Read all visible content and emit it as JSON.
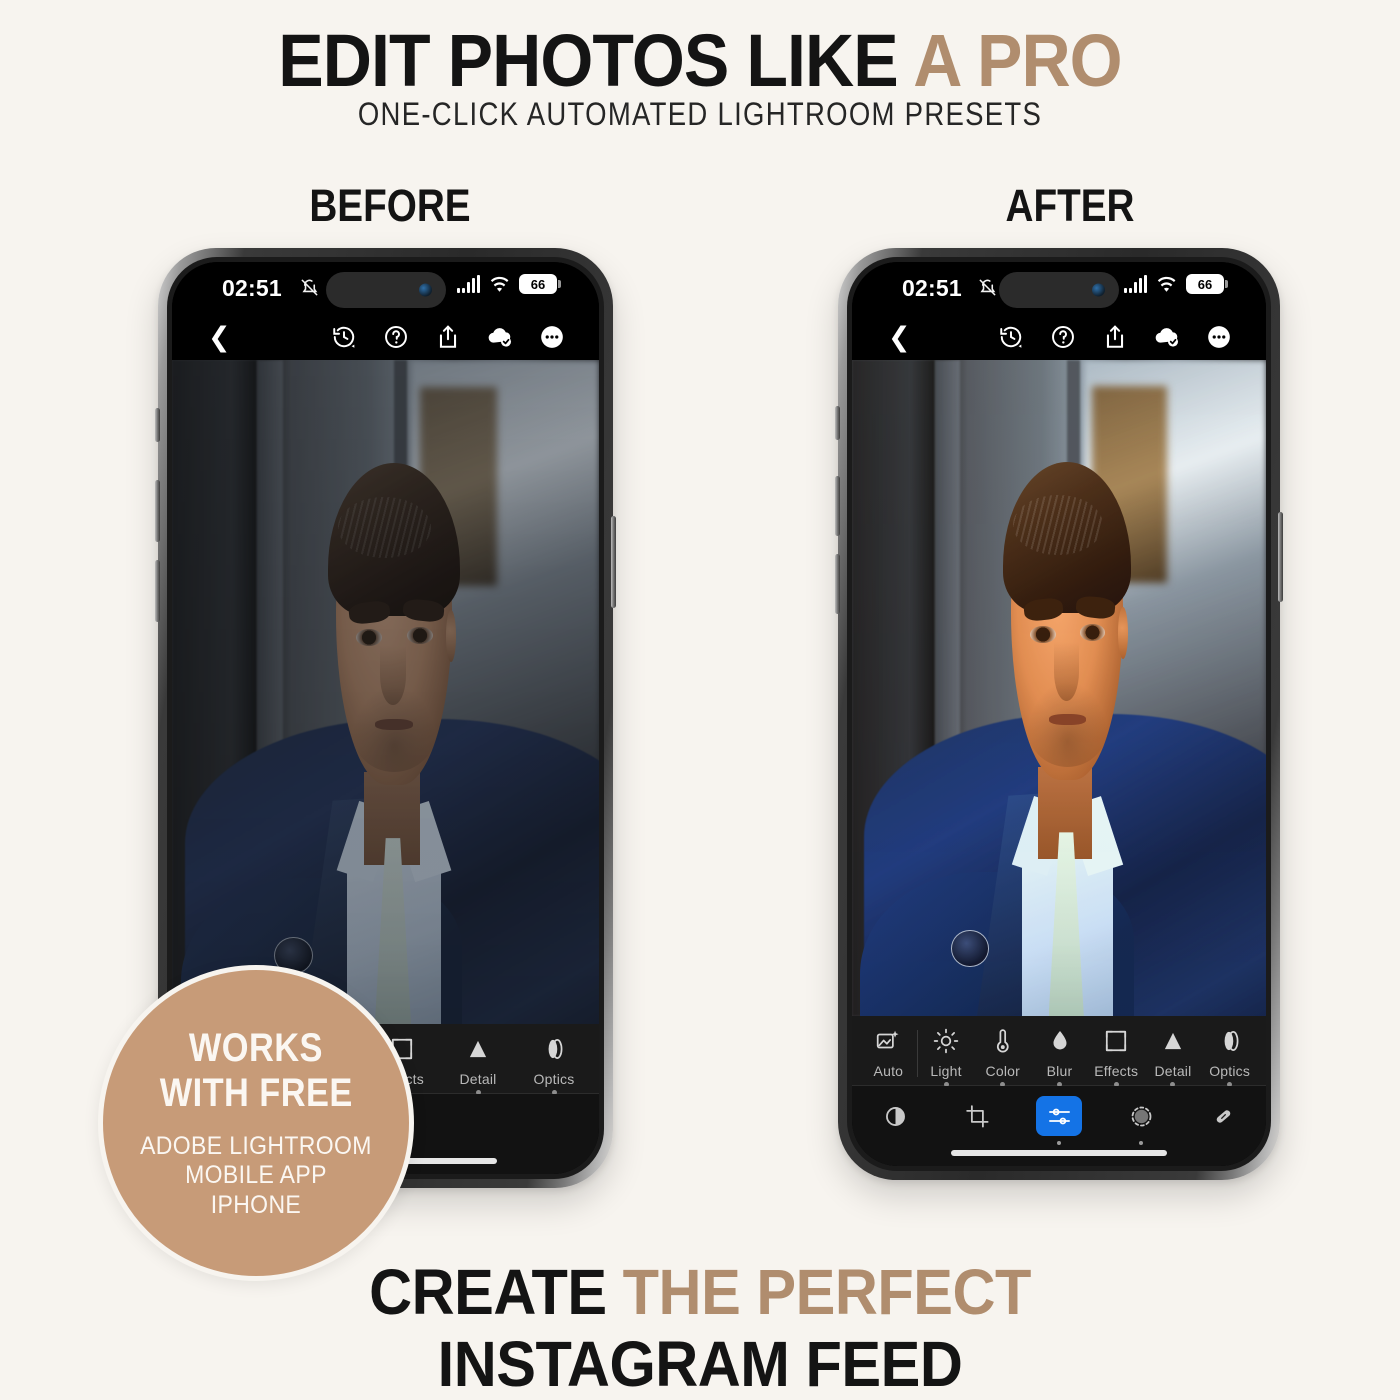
{
  "theme": {
    "background": "#F7F4EF",
    "accent_tan": "#B08D6E",
    "badge_fill": "#C79B78",
    "text_dark": "#141414",
    "active_blue": "#1473E6"
  },
  "header": {
    "title_plain": "EDIT PHOTOS LIKE ",
    "title_accent": "A PRO",
    "subtitle": "ONE-CLICK AUTOMATED LIGHTROOM PRESETS"
  },
  "comparison": {
    "before_label": "BEFORE",
    "after_label": "AFTER"
  },
  "phones": {
    "before": {
      "status_bar": {
        "time": "02:51",
        "mute_icon": "bell-slash-icon",
        "signal_icon": "cellular-bars-icon",
        "wifi_icon": "wifi-icon",
        "battery_level": "66"
      },
      "top_toolbar": {
        "back_icon": "chevron-left-icon",
        "actions": [
          {
            "icon": "history-clock-icon",
            "name": "version-history-button"
          },
          {
            "icon": "question-circle-icon",
            "name": "help-button"
          },
          {
            "icon": "share-up-icon",
            "name": "share-button"
          },
          {
            "icon": "cloud-check-icon",
            "name": "cloud-synced-button"
          },
          {
            "icon": "ellipsis-circle-icon",
            "name": "more-options-button"
          }
        ]
      },
      "edit_tabs": [
        {
          "label": "Effects",
          "icon": "effects-frame-icon"
        },
        {
          "label": "Detail",
          "icon": "detail-triangle-icon"
        },
        {
          "label": "Optics",
          "icon": "optics-lens-icon"
        }
      ],
      "tool_row": [
        {
          "icon": "masking-dashed-circle-icon",
          "name": "masking-tool",
          "active": false
        },
        {
          "icon": "healing-brush-icon",
          "name": "healing-tool",
          "active": false
        }
      ]
    },
    "after": {
      "status_bar": {
        "time": "02:51",
        "mute_icon": "bell-slash-icon",
        "signal_icon": "cellular-bars-icon",
        "wifi_icon": "wifi-icon",
        "battery_level": "66"
      },
      "top_toolbar": {
        "back_icon": "chevron-left-icon",
        "actions": [
          {
            "icon": "history-clock-icon",
            "name": "version-history-button"
          },
          {
            "icon": "question-circle-icon",
            "name": "help-button"
          },
          {
            "icon": "share-up-icon",
            "name": "share-button"
          },
          {
            "icon": "cloud-check-icon",
            "name": "cloud-synced-button"
          },
          {
            "icon": "ellipsis-circle-icon",
            "name": "more-options-button"
          }
        ]
      },
      "edit_tabs": [
        {
          "label": "Auto",
          "icon": "auto-magic-photo-icon"
        },
        {
          "label": "Light",
          "icon": "sun-icon"
        },
        {
          "label": "Color",
          "icon": "thermometer-icon"
        },
        {
          "label": "Blur",
          "icon": "water-drop-icon"
        },
        {
          "label": "Effects",
          "icon": "effects-frame-icon"
        },
        {
          "label": "Detail",
          "icon": "detail-triangle-icon"
        },
        {
          "label": "Optics",
          "icon": "optics-lens-icon"
        }
      ],
      "tool_row": [
        {
          "icon": "presets-circle-icon",
          "name": "presets-tool",
          "active": false
        },
        {
          "icon": "crop-rotate-icon",
          "name": "crop-tool",
          "active": false
        },
        {
          "icon": "sliders-adjust-icon",
          "name": "edit-tool",
          "active": true
        },
        {
          "icon": "masking-dashed-circle-icon",
          "name": "masking-tool",
          "active": false
        },
        {
          "icon": "healing-brush-icon",
          "name": "healing-tool",
          "active": false
        }
      ]
    }
  },
  "badge": {
    "line1": "WORKS",
    "line2": "WITH FREE",
    "sub_line1": "ADOBE LIGHTROOM",
    "sub_line2": "MOBILE APP",
    "sub_line3": "IPHONE"
  },
  "footer": {
    "line1_plain": "CREATE ",
    "line1_accent": "THE PERFECT",
    "line2": "INSTAGRAM FEED"
  }
}
